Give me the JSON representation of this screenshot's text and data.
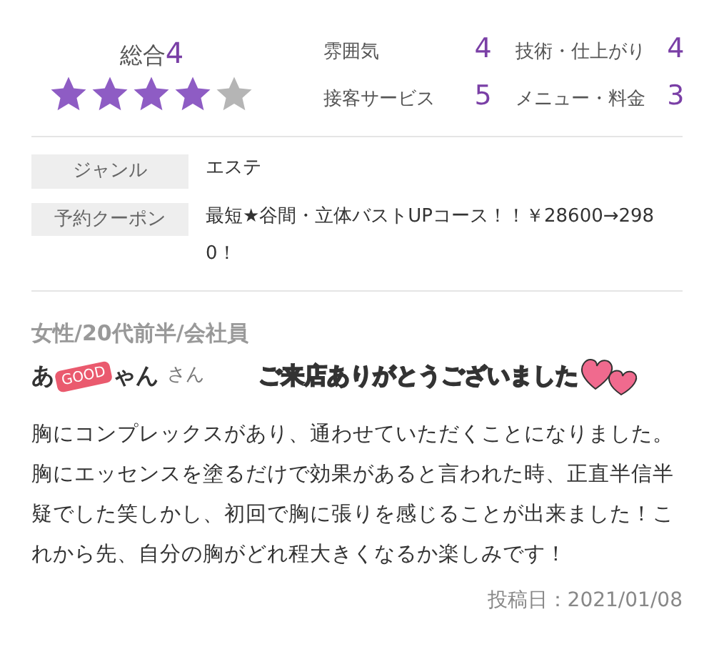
{
  "overall": {
    "label": "総合",
    "score": "4",
    "stars": 4
  },
  "ratings": [
    {
      "label": "雰囲気",
      "score": "4"
    },
    {
      "label": "技術・仕上がり",
      "score": "4"
    },
    {
      "label": "接客サービス",
      "score": "5"
    },
    {
      "label": "メニュー・料金",
      "score": "3"
    }
  ],
  "details": [
    {
      "label": "ジャンル",
      "value": "エステ"
    },
    {
      "label": "予約クーポン",
      "value": "最短★谷間・立体バストUPコース！！￥28600→2980！"
    }
  ],
  "reviewer": {
    "profile": "女性/20代前半/会社員",
    "name_start": "あ",
    "name_end": "ゃん",
    "honorific": "さん",
    "sticker": "GOOD"
  },
  "banner": "ご来店ありがとうございました",
  "body": "胸にコンプレックスがあり、通わせていただくことになりました。胸にエッセンスを塗るだけで効果があると言われた時、正直半信半疑でした笑しかし、初回で胸に張りを感じることが出来ました！これから先、自分の胸がどれ程大きくなるか楽しみです！",
  "posted": "投稿日：2021/01/08"
}
